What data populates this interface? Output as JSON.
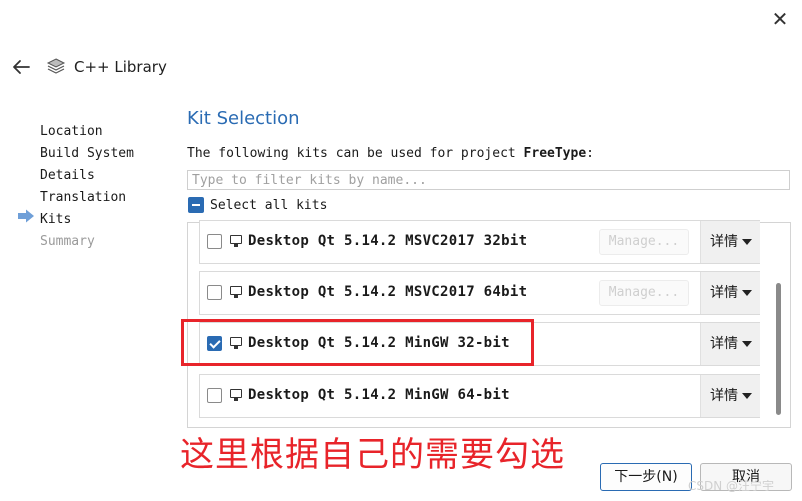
{
  "header": {
    "title": "C++ Library",
    "close_icon": "close-icon",
    "back_icon": "back-arrow-icon"
  },
  "steps": [
    "Location",
    "Build System",
    "Details",
    "Translation",
    "Kits",
    "Summary"
  ],
  "current_step": "Kits",
  "page": {
    "title": "Kit Selection",
    "description_prefix": "The following kits can be used for project ",
    "project_name": "FreeType",
    "description_suffix": ":",
    "filter_placeholder": "Type to filter kits by name...",
    "select_all_label": "Select all kits"
  },
  "kits": [
    {
      "name": "Desktop Qt 5.14.2 MSVC2017 32bit",
      "checked": false,
      "manage_label": "Manage...",
      "details_label": "详情"
    },
    {
      "name": "Desktop Qt 5.14.2 MSVC2017 64bit",
      "checked": false,
      "manage_label": "Manage...",
      "details_label": "详情"
    },
    {
      "name": "Desktop Qt 5.14.2 MinGW 32-bit",
      "checked": true,
      "manage_label": "",
      "details_label": "详情"
    },
    {
      "name": "Desktop Qt 5.14.2 MinGW 64-bit",
      "checked": false,
      "manage_label": "",
      "details_label": "详情"
    }
  ],
  "annotation": "这里根据自己的需要勾选",
  "footer": {
    "next_label": "下一步(N)",
    "cancel_label": "取消"
  },
  "watermark": "CSDN @汪宁宇",
  "colors": {
    "accent": "#2a6bb3",
    "highlight": "#e8242a"
  }
}
